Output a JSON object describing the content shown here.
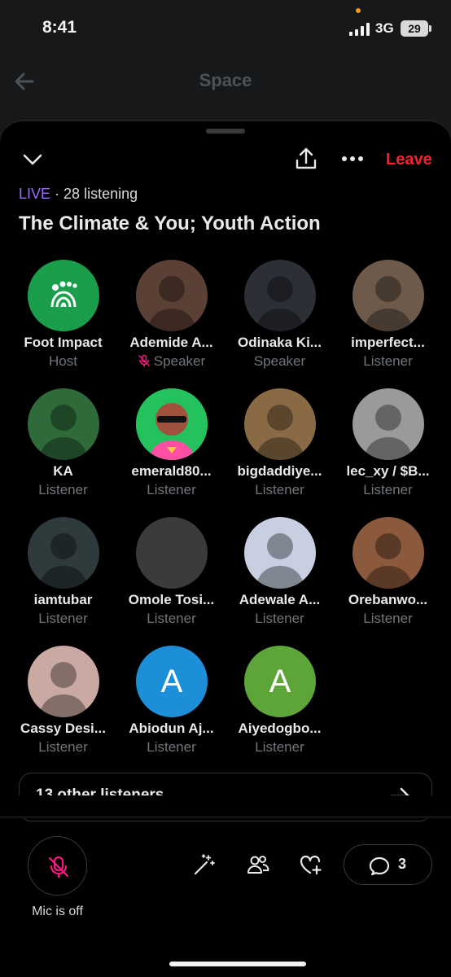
{
  "status_bar": {
    "time": "8:41",
    "network": "3G",
    "battery": "29"
  },
  "background": {
    "title": "Space"
  },
  "space": {
    "leave_label": "Leave",
    "live_label": "LIVE",
    "listening": "28 listening",
    "title": "The Climate & You; Youth Action"
  },
  "participants": [
    {
      "name": "Foot Impact",
      "role": "Host",
      "avatar": "foot-impact-logo",
      "color": "#1a9e4b"
    },
    {
      "name": "Ademide A...",
      "role": "Speaker",
      "muted": true,
      "avatar": "photo",
      "color": "#5b4035"
    },
    {
      "name": "Odinaka Ki...",
      "role": "Speaker",
      "avatar": "photo",
      "color": "#2c2f36"
    },
    {
      "name": "imperfect...",
      "role": "Listener",
      "avatar": "photo",
      "color": "#6d5a4b"
    },
    {
      "name": "KA",
      "role": "Listener",
      "avatar": "photo",
      "color": "#2f6b3a"
    },
    {
      "name": "emerald80...",
      "role": "Listener",
      "avatar": "cartoon",
      "color": "#23c25d"
    },
    {
      "name": "bigdaddiye...",
      "role": "Listener",
      "avatar": "photo",
      "color": "#8a6a45"
    },
    {
      "name": "lec_xy / $B...",
      "role": "Listener",
      "avatar": "photo",
      "color": "#9a9a9a"
    },
    {
      "name": "iamtubar",
      "role": "Listener",
      "avatar": "photo",
      "color": "#2e3a3b"
    },
    {
      "name": "Omole Tosi...",
      "role": "Listener",
      "avatar": "blank",
      "color": "#3a3b3d"
    },
    {
      "name": "Adewale A...",
      "role": "Listener",
      "avatar": "photo",
      "color": "#c7cfe0"
    },
    {
      "name": "Orebanwo...",
      "role": "Listener",
      "avatar": "photo",
      "color": "#8b5a3c"
    },
    {
      "name": "Cassy Desi...",
      "role": "Listener",
      "avatar": "photo",
      "color": "#c9a9a1"
    },
    {
      "name": "Abiodun Aj...",
      "role": "Listener",
      "avatar": "letter",
      "letter": "A",
      "color": "#1d8fd8"
    },
    {
      "name": "Aiyedogbo...",
      "role": "Listener",
      "avatar": "letter",
      "letter": "A",
      "color": "#5da539"
    }
  ],
  "others": {
    "label": "13 other listeners"
  },
  "controls": {
    "mic_label": "Mic is off",
    "comment_count": "3"
  },
  "colors": {
    "accent_live": "#9b6bff",
    "leave": "#f4212e",
    "mic_off": "#f91880"
  }
}
